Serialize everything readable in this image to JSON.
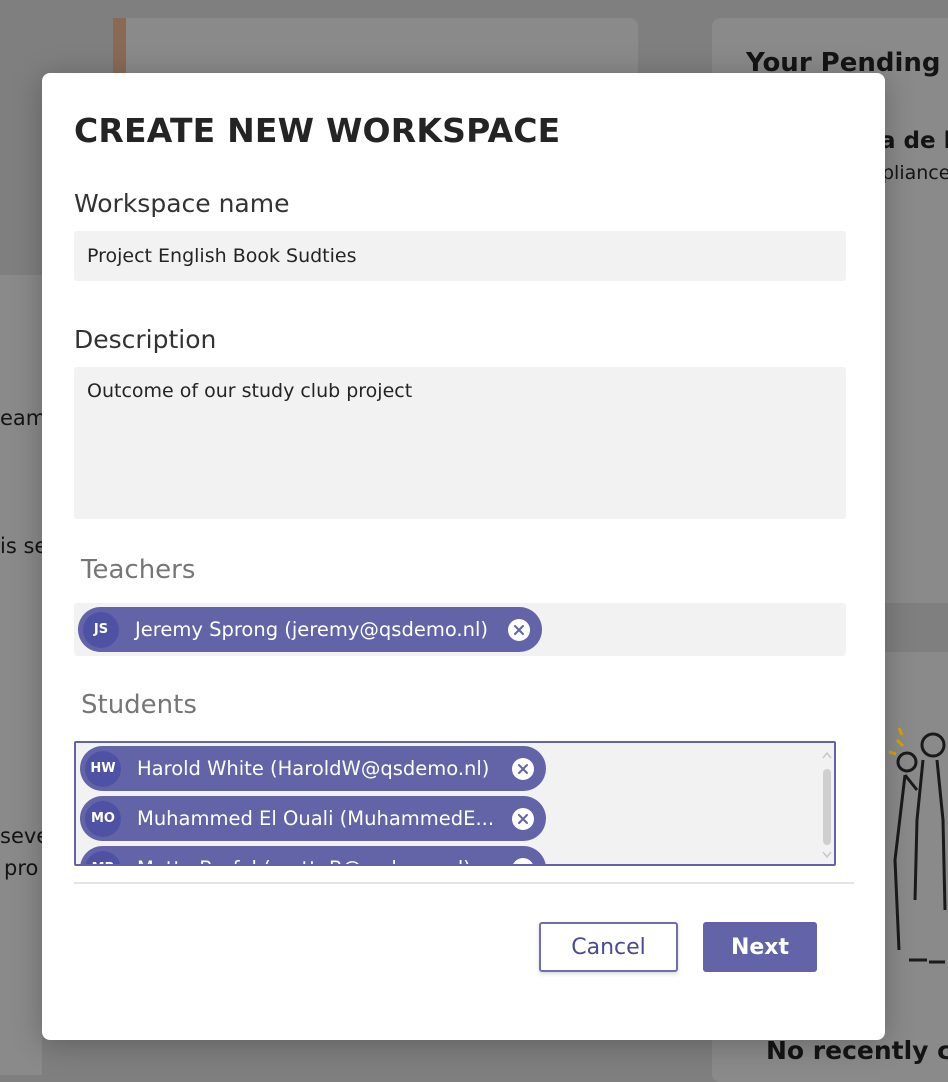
{
  "background": {
    "pending_title": "Your Pending R",
    "pending_item": "a de l",
    "pending_sub": "pliance",
    "left_fragment_1": "eam",
    "left_fragment_2": "is se",
    "left_fragment_3": "seve",
    "left_fragment_4": "pro",
    "bottom_right": "No recently cr"
  },
  "modal": {
    "title": "CREATE NEW WORKSPACE",
    "workspace_name": {
      "label": "Workspace name",
      "value": "Project English Book Sudties"
    },
    "description": {
      "label": "Description",
      "value": "Outcome of our study club project"
    },
    "teachers": {
      "label": "Teachers",
      "people": [
        {
          "initials": "JS",
          "label": "Jeremy Sprong (jeremy@qsdemo.nl)"
        }
      ]
    },
    "students": {
      "label": "Students",
      "people": [
        {
          "initials": "HW",
          "label": "Harold White (HaroldW@qsdemo.nl)"
        },
        {
          "initials": "MO",
          "label": "Muhammed El Ouali (MuhammedE..."
        },
        {
          "initials": "MB",
          "label": "Mette Borfal (metteB@qsdemo.nl)"
        }
      ]
    },
    "buttons": {
      "cancel": "Cancel",
      "next": "Next"
    }
  },
  "colors": {
    "accent": "#6264a7",
    "overlay": "#7f7f7f",
    "field": "#f2f2f2"
  }
}
